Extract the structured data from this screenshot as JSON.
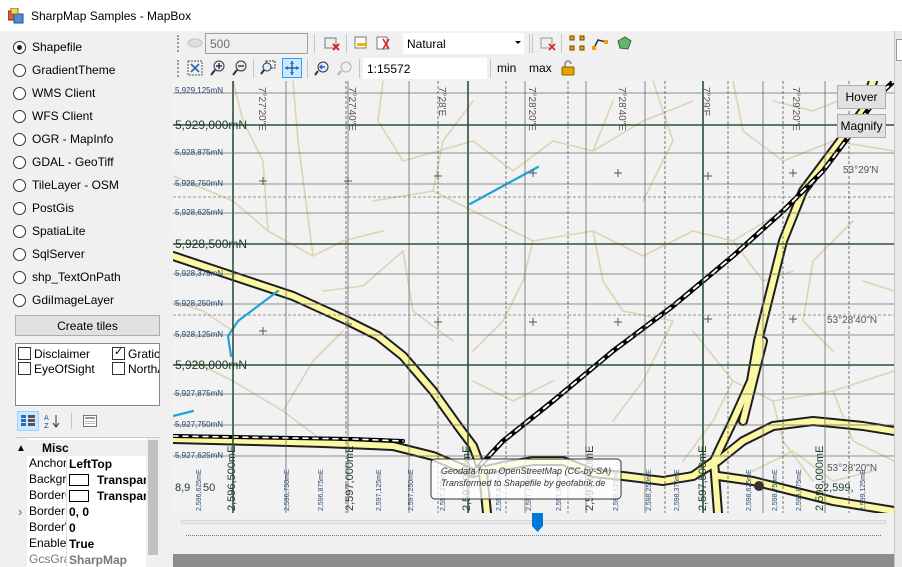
{
  "window": {
    "title": "SharpMap Samples - MapBox"
  },
  "samples": [
    {
      "label": "Shapefile",
      "checked": true
    },
    {
      "label": "GradientTheme",
      "checked": false
    },
    {
      "label": "WMS Client",
      "checked": false
    },
    {
      "label": "WFS Client",
      "checked": false
    },
    {
      "label": "OGR - MapInfo",
      "checked": false
    },
    {
      "label": "GDAL - GeoTiff",
      "checked": false
    },
    {
      "label": "TileLayer - OSM",
      "checked": false
    },
    {
      "label": "PostGis",
      "checked": false
    },
    {
      "label": "SpatiaLite",
      "checked": false
    },
    {
      "label": "SqlServer",
      "checked": false
    },
    {
      "label": "shp_TextOnPath",
      "checked": false
    },
    {
      "label": "GdiImageLayer",
      "checked": false
    }
  ],
  "create_tiles_label": "Create tiles",
  "layers": [
    {
      "label": "Disclaimer",
      "checked": false
    },
    {
      "label": "Graticule",
      "checked": true
    },
    {
      "label": "EyeOfSight",
      "checked": false
    },
    {
      "label": "NorthArrow",
      "checked": false
    }
  ],
  "properties": {
    "category": "Misc",
    "rows": [
      {
        "name": "Anchor",
        "value": "LeftTop",
        "swatch": false
      },
      {
        "name": "BackgroundColor",
        "value": "Transparent",
        "swatch": true
      },
      {
        "name": "BorderColor",
        "value": "Transparent",
        "swatch": true
      },
      {
        "name": "BorderMargin",
        "value": "0, 0",
        "swatch": false
      },
      {
        "name": "BorderWidth",
        "value": "0",
        "swatch": false
      },
      {
        "name": "Enabled",
        "value": "True",
        "swatch": false
      },
      {
        "name": "GcsGraticuleStyle",
        "value": "SharpMap",
        "swatch": false
      }
    ]
  },
  "toolbar": {
    "number_value": "500",
    "combo_value": "Natural",
    "scale_value": "1:15572",
    "min_label": "min",
    "max_label": "max"
  },
  "map": {
    "hover_label": "Hover",
    "magnify_label": "Magnify",
    "northing_labels": [
      "5,929,000mN",
      "5,928,500mN",
      "5,928,000mN"
    ],
    "minor_northing_labels": [
      "5,929,125mN",
      "5,928,875mN",
      "5,928,750mN",
      "5,928,625mN",
      "5,928,375mN",
      "5,928,250mN",
      "5,928,125mN",
      "5,927,875mN",
      "5,927,750mN",
      "5,927,625mN"
    ],
    "easting_labels": [
      "2,596,500mE",
      "2,597,000mE",
      "2,597,500mE",
      "2,598,000mE",
      "2,598,500mE",
      "2,599,000mE"
    ],
    "minor_easting_labels": [
      "2,596,625mE",
      "2,596,750mE",
      "2,596,875mE",
      "2,597,125mE",
      "2,597,250mE",
      "2,597,375mE",
      "2,597,625mE",
      "2,597,750mE",
      "2,597,875mE",
      "2,598,125mE",
      "2,598,250mE",
      "2,598,375mE",
      "2,598,625mE",
      "2,598,750mE",
      "2,598,875mE",
      "2,599,125mE"
    ],
    "longitude_labels": [
      "7°27'20\"E",
      "7°27'40\"E",
      "7°28'E",
      "7°28'20\"E",
      "7°28'40\"E",
      "7°29'E",
      "7°29'20\"E"
    ],
    "latitude_labels": [
      "53°29'N",
      "53°28'40\"N",
      "53°28'20\"N"
    ],
    "partial_labels": [
      "8,9",
      "50",
      "2,599,"
    ],
    "disclaimer_lines": [
      "Geodata from OpenStreetMap (CC-by-SA)",
      "Transformed to Shapefile by geofabrik.de"
    ],
    "colors": {
      "major_road": "#fbf7a2",
      "road_casing": "#1e1e1e",
      "minor_road": "#d9d6b4",
      "railway": "#000000",
      "waterway": "#1fa3d8",
      "grid": "#2e4f3a",
      "background": "#f2f2f2"
    }
  },
  "slider": {
    "value_fraction": 0.505
  }
}
